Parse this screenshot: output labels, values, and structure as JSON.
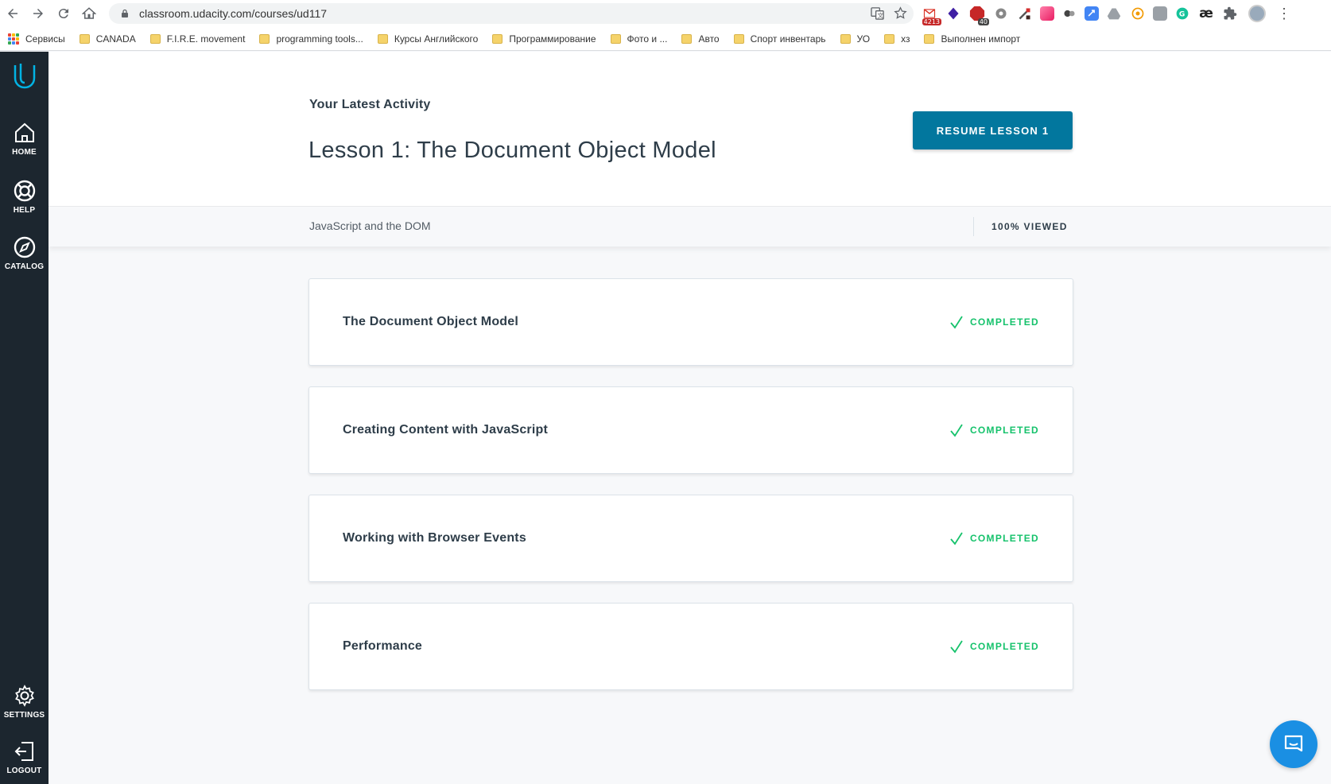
{
  "browser": {
    "url": "classroom.udacity.com/courses/ud117",
    "bookmarks": [
      {
        "label": "Сервисы",
        "type": "apps"
      },
      {
        "label": "CANADA",
        "type": "folder"
      },
      {
        "label": "F.I.R.E. movement",
        "type": "folder"
      },
      {
        "label": "programming tools...",
        "type": "folder"
      },
      {
        "label": "Курсы Английского",
        "type": "folder"
      },
      {
        "label": "Программирование",
        "type": "folder"
      },
      {
        "label": "Фото и ...",
        "type": "folder"
      },
      {
        "label": "Авто",
        "type": "folder"
      },
      {
        "label": "Спорт инвентарь",
        "type": "folder"
      },
      {
        "label": "УО",
        "type": "folder"
      },
      {
        "label": "хз",
        "type": "folder"
      },
      {
        "label": "Выполнен импорт",
        "type": "folder"
      }
    ],
    "extensions": [
      {
        "name": "gmail-icon",
        "color": "#d93025",
        "badge": "4213"
      },
      {
        "name": "extension-diamond-icon",
        "color": "#3f1fa3",
        "badge": ""
      },
      {
        "name": "adblock-icon",
        "color": "#c62828",
        "badge": "40"
      },
      {
        "name": "extension-gear-icon",
        "color": "#888888",
        "badge": ""
      },
      {
        "name": "extension-tool-icon",
        "color": "#555555",
        "badge": ""
      },
      {
        "name": "extension-gradient-icon",
        "color": "#e94e9b",
        "badge": ""
      },
      {
        "name": "extension-dots-icon",
        "color": "#444444",
        "badge": ""
      },
      {
        "name": "extension-sync-icon",
        "color": "#4285f4",
        "badge": ""
      },
      {
        "name": "google-drive-icon",
        "color": "#888888",
        "badge": ""
      },
      {
        "name": "extension-coin-icon",
        "color": "#f29900",
        "badge": ""
      },
      {
        "name": "extension-photo-icon",
        "color": "#9aa0a6",
        "badge": ""
      },
      {
        "name": "grammarly-icon",
        "color": "#15c39a",
        "badge": ""
      },
      {
        "name": "ae-icon",
        "color": "#222222",
        "badge": ""
      },
      {
        "name": "extensions-puzzle-icon",
        "color": "#5f6368",
        "badge": ""
      }
    ],
    "ae_text": "æ"
  },
  "sidebar": {
    "items_top": [
      {
        "label": "HOME",
        "icon": "home-icon"
      },
      {
        "label": "HELP",
        "icon": "help-lifebuoy-icon"
      },
      {
        "label": "CATALOG",
        "icon": "catalog-compass-icon"
      }
    ],
    "items_bottom": [
      {
        "label": "SETTINGS",
        "icon": "gear-icon"
      },
      {
        "label": "LOGOUT",
        "icon": "logout-icon"
      }
    ]
  },
  "header": {
    "latest_label": "Your Latest Activity",
    "lesson_title": "Lesson 1: The Document Object Model",
    "resume_button": "RESUME LESSON 1"
  },
  "course_bar": {
    "course_name": "JavaScript and the DOM",
    "progress": "100% VIEWED"
  },
  "lessons": [
    {
      "title": "The Document Object Model",
      "status": "COMPLETED"
    },
    {
      "title": "Creating Content with JavaScript",
      "status": "COMPLETED"
    },
    {
      "title": "Working with Browser Events",
      "status": "COMPLETED"
    },
    {
      "title": "Performance",
      "status": "COMPLETED"
    }
  ],
  "colors": {
    "sidebar_bg": "#1c262f",
    "accent": "#02779e",
    "completed": "#15c26b",
    "logo": "#02b3e4"
  }
}
